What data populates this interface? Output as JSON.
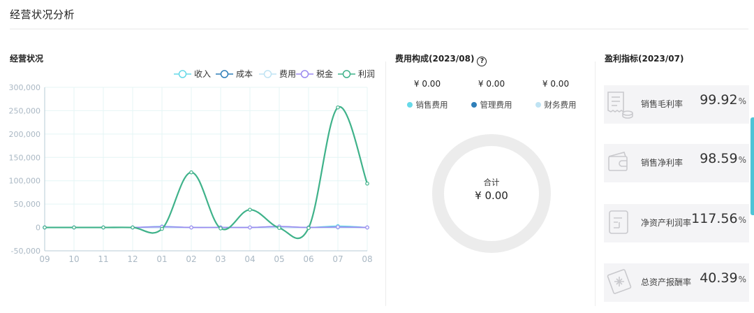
{
  "page": {
    "title": "经营状况分析"
  },
  "business": {
    "title": "经营状况",
    "legend": [
      {
        "name": "收入",
        "color": "#67d9e8"
      },
      {
        "name": "成本",
        "color": "#2f7fb9"
      },
      {
        "name": "费用",
        "color": "#bfe3f3"
      },
      {
        "name": "税金",
        "color": "#9b8af0"
      },
      {
        "name": "利润",
        "color": "#3fb28a"
      }
    ]
  },
  "chart_data": {
    "type": "line",
    "categories": [
      "09",
      "10",
      "11",
      "12",
      "01",
      "02",
      "03",
      "04",
      "05",
      "06",
      "07",
      "08"
    ],
    "ylim": [
      -50000,
      300000
    ],
    "yticks": [
      -50000,
      0,
      50000,
      100000,
      150000,
      200000,
      250000,
      300000
    ],
    "ytick_labels": [
      "-50,000",
      "0",
      "50,000",
      "100,000",
      "150,000",
      "200,000",
      "250,000",
      "300,000"
    ],
    "grid": true,
    "legend_position": "top-right",
    "series": [
      {
        "name": "收入",
        "color": "#67d9e8",
        "values": [
          0,
          0,
          0,
          0,
          2000,
          0,
          0,
          0,
          2000,
          0,
          3000,
          0
        ]
      },
      {
        "name": "成本",
        "color": "#2f7fb9",
        "values": [
          0,
          0,
          0,
          0,
          0,
          0,
          0,
          0,
          0,
          0,
          0,
          0
        ]
      },
      {
        "name": "费用",
        "color": "#bfe3f3",
        "values": [
          0,
          0,
          0,
          0,
          0,
          0,
          0,
          0,
          0,
          0,
          0,
          0
        ]
      },
      {
        "name": "税金",
        "color": "#9b8af0",
        "values": [
          0,
          0,
          0,
          0,
          1500,
          0,
          0,
          0,
          2000,
          0,
          1000,
          0
        ]
      },
      {
        "name": "利润",
        "color": "#3fb28a",
        "values": [
          0,
          0,
          0,
          0,
          -3000,
          118000,
          -2000,
          38000,
          -1000,
          -1000,
          257000,
          94000
        ]
      }
    ]
  },
  "cost": {
    "title": "费用构成(2023/08)",
    "help_glyph": "?",
    "items": [
      {
        "value": "¥ 0.00",
        "label": "销售费用",
        "color": "#67d9e8"
      },
      {
        "value": "¥ 0.00",
        "label": "管理费用",
        "color": "#2f7fb9"
      },
      {
        "value": "¥ 0.00",
        "label": "财务费用",
        "color": "#bfe3f3"
      }
    ],
    "total_label": "合计",
    "total_value": "¥ 0.00"
  },
  "profit": {
    "title": "盈利指标(2023/07)",
    "cards": [
      {
        "icon": "receipt-coins-icon",
        "label": "销售毛利率",
        "value": "99.92",
        "unit": "%"
      },
      {
        "icon": "wallet-icon",
        "label": "销售净利率",
        "value": "98.59",
        "unit": "%"
      },
      {
        "icon": "document-icon",
        "label": "净资产利润率",
        "value": "117.56",
        "unit": "%"
      },
      {
        "icon": "certificate-icon",
        "label": "总资产报酬率",
        "value": "40.39",
        "unit": "%"
      }
    ]
  }
}
